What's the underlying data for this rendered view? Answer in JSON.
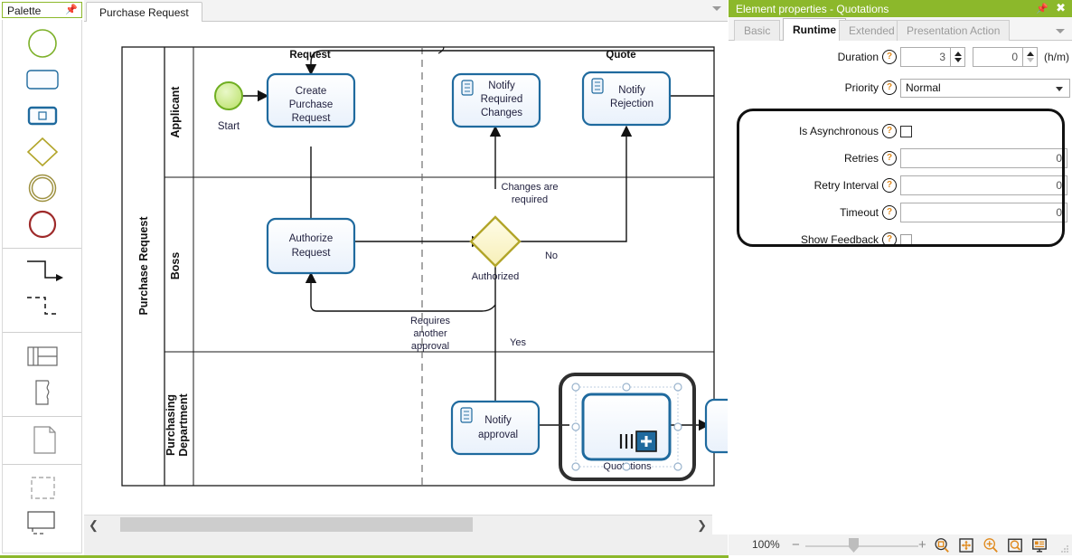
{
  "palette": {
    "title": "Palette",
    "pin_icon": "pin-icon",
    "groups": [
      {
        "items": [
          {
            "name": "start-event-shape",
            "icon": "circle-green"
          },
          {
            "name": "task-shape",
            "icon": "rounded-rect-blue"
          },
          {
            "name": "subprocess-shape",
            "icon": "rounded-rect-bold-blue"
          },
          {
            "name": "gateway-shape",
            "icon": "diamond-olive"
          },
          {
            "name": "intermediate-event-shape",
            "icon": "double-circle-olive"
          },
          {
            "name": "end-event-shape",
            "icon": "circle-red"
          }
        ]
      },
      {
        "items": [
          {
            "name": "sequence-flow-connector",
            "icon": "solid-arrow-connector"
          },
          {
            "name": "message-flow-connector",
            "icon": "dashed-arrow-connector"
          }
        ]
      },
      {
        "items": [
          {
            "name": "pool-shape",
            "icon": "table-grid"
          },
          {
            "name": "data-object-shape",
            "icon": "curled-page"
          }
        ]
      },
      {
        "items": [
          {
            "name": "document-shape",
            "icon": "page-corner"
          }
        ]
      },
      {
        "items": [
          {
            "name": "group-shape",
            "icon": "dashed-square"
          },
          {
            "name": "annotation-shape",
            "icon": "text-annotation"
          }
        ]
      }
    ]
  },
  "tabbar": {
    "tabs": [
      {
        "label": "Purchase Request",
        "active": true
      }
    ],
    "overflow_icon": "chevron-down-icon"
  },
  "diagram": {
    "pool_label": "Purchase Request",
    "lanes": [
      {
        "label": "Applicant"
      },
      {
        "label": "Boss"
      },
      {
        "label": "Purchasing\nDepartment"
      }
    ],
    "nodes": [
      {
        "id": "start",
        "type": "start-event",
        "label": "Start"
      },
      {
        "id": "create",
        "type": "user-task",
        "label": "Create\nPurchase\nRequest"
      },
      {
        "id": "notify_changes",
        "type": "send-task",
        "label": "Notify\nRequired\nChanges"
      },
      {
        "id": "notify_rejection",
        "type": "send-task",
        "label": "Notify\nRejection"
      },
      {
        "id": "authorize",
        "type": "user-task",
        "label": "Authorize\nRequest"
      },
      {
        "id": "gateway",
        "type": "exclusive-gateway",
        "label": "Authorized"
      },
      {
        "id": "notify_approval",
        "type": "send-task",
        "label": "Notify\napproval"
      },
      {
        "id": "quotations",
        "type": "sub-process",
        "label": "Quotations",
        "selected": true
      }
    ],
    "flow_labels": [
      {
        "text": "Request"
      },
      {
        "text": "Quote"
      },
      {
        "text": "Changes are\nrequired"
      },
      {
        "text": "No"
      },
      {
        "text": "Yes"
      },
      {
        "text": "Requires\nanother\napproval"
      }
    ],
    "hscroll": {
      "left_icon": "chevron-left-icon",
      "right_icon": "chevron-right-icon"
    },
    "vscroll": {
      "up_icon": "chevron-up-icon",
      "down_icon": "chevron-down-icon"
    }
  },
  "properties": {
    "title": "Element properties - Quotations",
    "pin_icon": "pin-icon",
    "close_icon": "close-icon",
    "tabs": [
      {
        "label": "Basic",
        "active": false
      },
      {
        "label": "Runtime",
        "active": true
      },
      {
        "label": "Extended",
        "active": false
      },
      {
        "label": "Presentation Action",
        "active": false
      }
    ],
    "overflow_icon": "chevron-down-icon",
    "fields": {
      "duration_label": "Duration",
      "duration_hours": "3",
      "duration_minutes": "0",
      "duration_unit": "(h/m)",
      "priority_label": "Priority",
      "priority_value": "Normal",
      "priority_options": [
        "Normal"
      ],
      "is_asynchronous_label": "Is Asynchronous",
      "is_asynchronous_checked": false,
      "retries_label": "Retries",
      "retries_value": "0",
      "retry_interval_label": "Retry Interval",
      "retry_interval_value": "0",
      "timeout_label": "Timeout",
      "timeout_value": "0",
      "show_feedback_label": "Show Feedback",
      "show_feedback_checked": false,
      "help_icon": "question-mark-icon"
    }
  },
  "statusbar": {
    "zoom_percent": "100%",
    "zoom_out_icon": "minus-icon",
    "zoom_in_icon": "plus-icon",
    "buttons": [
      {
        "name": "zoom-to-selection-icon"
      },
      {
        "name": "fit-to-page-icon"
      },
      {
        "name": "zoom-in-icon"
      },
      {
        "name": "zoom-area-icon"
      },
      {
        "name": "presentation-mode-icon"
      }
    ],
    "grip_icon": "resize-grip-icon"
  },
  "colors": {
    "accent_green": "#8cb82b",
    "task_border": "#1f6a9e",
    "task_fill": "#f2f7fd",
    "gateway_fill": "#fcf7d0",
    "gateway_border": "#b2a52a",
    "start_fill": "#ddf0a8",
    "start_border": "#7cb028",
    "end_border": "#9e2a2a",
    "help_orange": "#e08a1e"
  }
}
